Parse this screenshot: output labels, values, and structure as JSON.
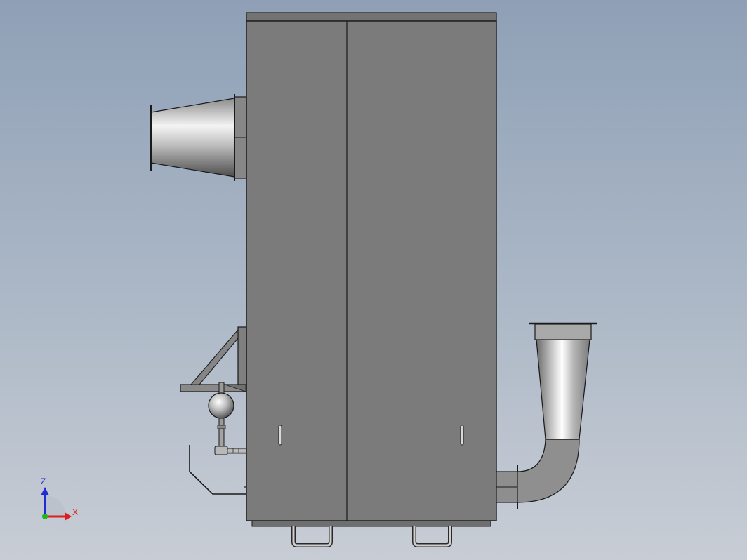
{
  "view": {
    "background_top": "#8fa0b6",
    "background_bottom": "#c8cdd5"
  },
  "model": {
    "cabinet_color": "#7b7b7b",
    "outline_color": "#1a1a1a",
    "duct_light": "#f2f2f2",
    "duct_dark": "#5a5a5a"
  },
  "triad": {
    "z_label": "Z",
    "x_label": "X",
    "z_color": "#1f2bd6",
    "x_color": "#d92020",
    "y_color": "#21b521"
  }
}
